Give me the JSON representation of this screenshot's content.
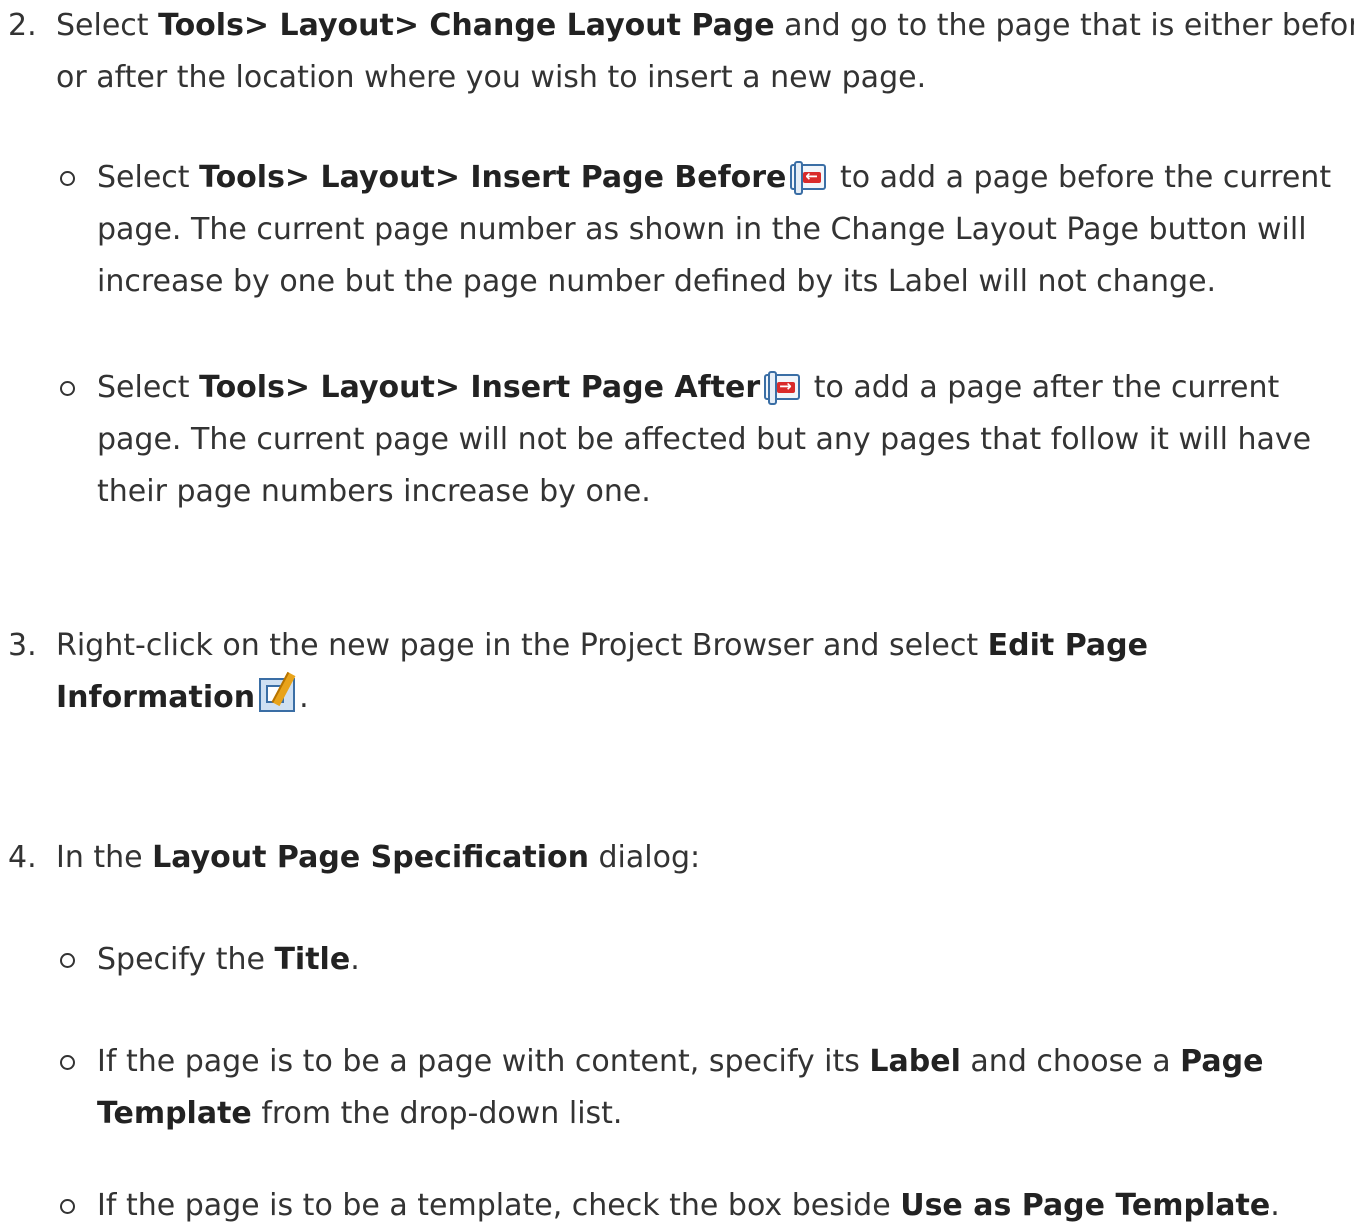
{
  "steps": [
    {
      "number": "2.",
      "lines": [
        {
          "pre": "Select ",
          "bold": "Tools> Layout> Change Layout Page",
          "post": " and go to the page that is either before"
        },
        {
          "text": "or after the location where you wish to insert a new page."
        }
      ],
      "bullets": [
        {
          "pre": "Select ",
          "bold": "Tools> Layout> Insert Page Before",
          "icon": "insert-page-before-icon",
          "post": " to add a page before the current",
          "lines": [
            "page. The current page number as shown in the Change Layout Page button will",
            "increase by one but the page number defined by its Label will not change."
          ]
        },
        {
          "pre": "Select ",
          "bold": "Tools> Layout> Insert Page After",
          "icon": "insert-page-after-icon",
          "post": " to add a page after the current",
          "lines": [
            "page. The current page will not be affected but any pages that follow it will have",
            "their page numbers increase by one."
          ]
        }
      ]
    },
    {
      "number": "3.",
      "pre": "Right-click on the new page in the Project Browser and select ",
      "bold1": "Edit Page",
      "bold2": "Information",
      "icon": "edit-page-information-icon",
      "post": "."
    },
    {
      "number": "4.",
      "pre": "In the ",
      "bold": "Layout Page Specification",
      "post": " dialog:",
      "bullets": [
        {
          "pre": "Specify the ",
          "bold": "Title",
          "post": "."
        },
        {
          "pre": "If the page is to be a page with content, specify its ",
          "bold": "Label",
          "mid": " and choose a ",
          "bold2": "Page",
          "line2_bold": "Template",
          "line2_post": " from the drop-down list."
        },
        {
          "pre": "If the page is to be a template, check the box beside ",
          "bold": "Use as Page Template",
          "post": "."
        }
      ]
    }
  ]
}
